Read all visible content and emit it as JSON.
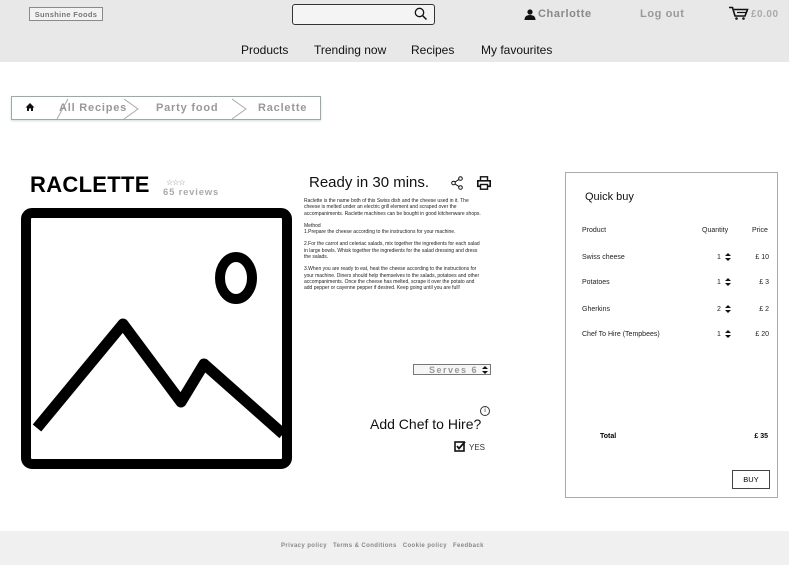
{
  "header": {
    "logo": "Sunshine Foods",
    "search_placeholder": "",
    "user_name": "Charlotte",
    "logout": "Log out",
    "cart_total": "£0.00"
  },
  "nav": [
    {
      "label": "Products"
    },
    {
      "label": "Trending now"
    },
    {
      "label": "Recipes"
    },
    {
      "label": "My favourites"
    }
  ],
  "breadcrumb": [
    "All Recipes",
    "Party food",
    "Raclette"
  ],
  "recipe": {
    "title": "RACLETTE",
    "stars": "☆☆☆",
    "reviews": "65 reviews",
    "ready": "Ready in 30 mins.",
    "description": [
      "Raclette is the name both of this Swiss dish and the cheese used in it. The cheese is melted under an electric grill element and scraped over the accompaniments. Raclette machines can be bought in good kitchenware shops.",
      "Method\n1.Prepare the cheese according to the instructions for your machine.",
      "2.For the carrot and celeriac salads, mix together the ingredients for each salad in large bowls. Whisk together the ingredients for the salad dressing and dress the salads.",
      "3.When you are ready to eat, heat the cheese according to the instructions for your machine. Diners should help themselves to the salads, potatoes and other accompaniments. Once the cheese has melted, scrape it over the potato and add pepper or cayenne pepper if desired. Keep going until you are full!"
    ],
    "serves_label": "Serves",
    "serves_value": "6",
    "chef_hire_label": "Add Chef to Hire?",
    "chef_hire_option": "YES"
  },
  "quick_buy": {
    "title": "Quick buy",
    "headers": {
      "product": "Product",
      "quantity": "Quantity",
      "price": "Price"
    },
    "rows": [
      {
        "product": "Swiss cheese",
        "qty": "1",
        "price": "£ 10"
      },
      {
        "product": "Potatoes",
        "qty": "1",
        "price": "£ 3"
      },
      {
        "product": "Gherkins",
        "qty": "2",
        "price": "£ 2"
      },
      {
        "product": "Chef To Hire (Tempbees)",
        "qty": "1",
        "price": "£ 20"
      }
    ],
    "total_label": "Total",
    "total_value": "£ 35",
    "buy_label": "BUY"
  },
  "footer": {
    "links": [
      "Privacy policy",
      "Terms & Conditions",
      "Cookie policy",
      "Feedback"
    ]
  }
}
